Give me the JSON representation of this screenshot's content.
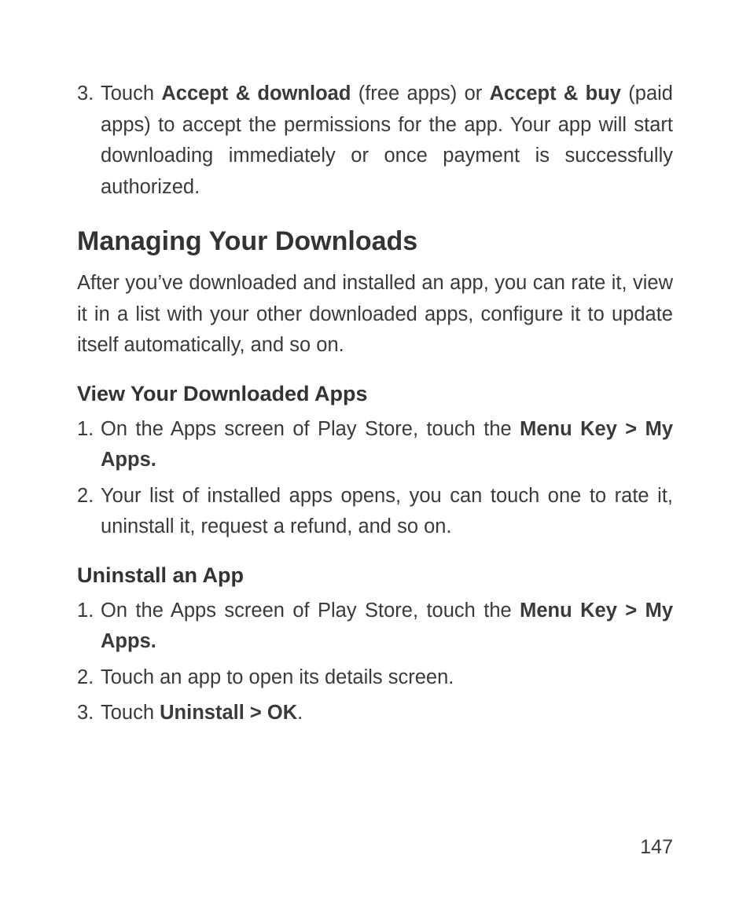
{
  "top_list": {
    "item3": {
      "num": "3.",
      "run1": "Touch ",
      "b1": "Accept & download",
      "run2": " (free apps) or ",
      "b2": "Accept & buy",
      "run3": " (paid apps) to accept the permissions for the app. Your app will start downloading immediately or once payment is success­fully authorized."
    }
  },
  "h2": "Managing Your Downloads",
  "para1": "After you’ve downloaded and installed an app, you can rate it, view it in a list with your other downloaded apps, configure it to update itself automatically, and so on.",
  "sub1": "View Your Downloaded Apps",
  "view_list": {
    "item1": {
      "num": "1.",
      "run1": "On the Apps screen of Play Store, touch the ",
      "b1": "Menu Key > My Apps."
    },
    "item2": {
      "num": "2.",
      "run1": "Your list of installed apps opens, you can touch one to rate it, uninstall it, request a refund, and so on."
    }
  },
  "sub2": "Uninstall an App",
  "uninstall_list": {
    "item1": {
      "num": "1.",
      "run1": "On the Apps screen of Play Store, touch the ",
      "b1": "Menu Key > My Apps."
    },
    "item2": {
      "num": "2.",
      "run1": "Touch an app to open its details screen."
    },
    "item3": {
      "num": "3.",
      "run1": "Touch ",
      "b1": "Uninstall > OK",
      "run2": "."
    }
  },
  "page_number": "147"
}
